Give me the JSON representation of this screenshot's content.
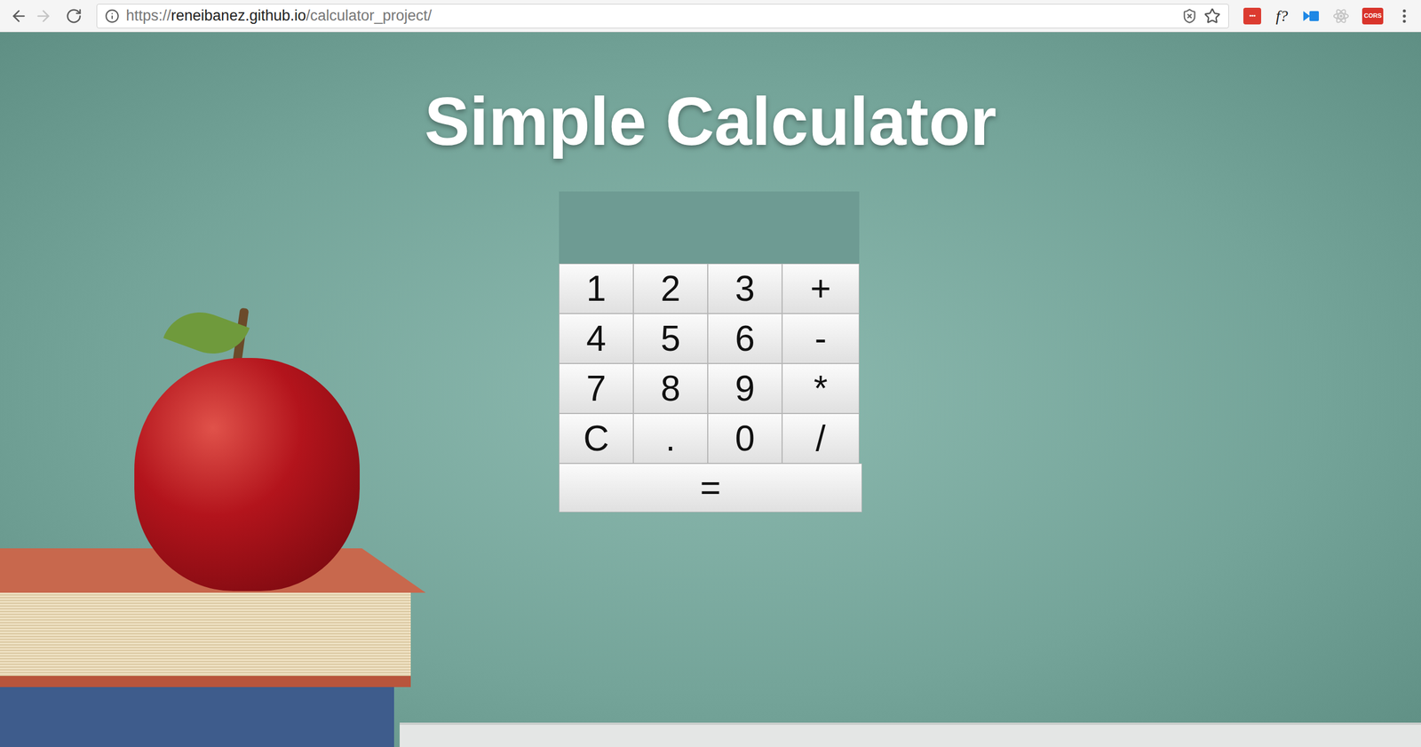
{
  "browser": {
    "back_disabled": false,
    "forward_disabled": true,
    "url": {
      "scheme": "https://",
      "host": "reneibanez.github.io",
      "path": "/calculator_project/"
    },
    "extensions": [
      {
        "kind": "badge",
        "label": "•••",
        "color": "#dc3b30"
      },
      {
        "kind": "text",
        "label": "f?"
      },
      {
        "kind": "arrow",
        "color": "#1e88e5"
      },
      {
        "kind": "atom",
        "color": "#c4c4c4"
      },
      {
        "kind": "badge",
        "label": "CORS",
        "color": "#d9342b"
      }
    ]
  },
  "page": {
    "title": "Simple Calculator"
  },
  "calculator": {
    "display": "",
    "keys": [
      [
        "1",
        "2",
        "3",
        "+"
      ],
      [
        "4",
        "5",
        "6",
        "-"
      ],
      [
        "7",
        "8",
        "9",
        "*"
      ],
      [
        "C",
        ".",
        "0",
        "/"
      ]
    ],
    "equals": "="
  }
}
